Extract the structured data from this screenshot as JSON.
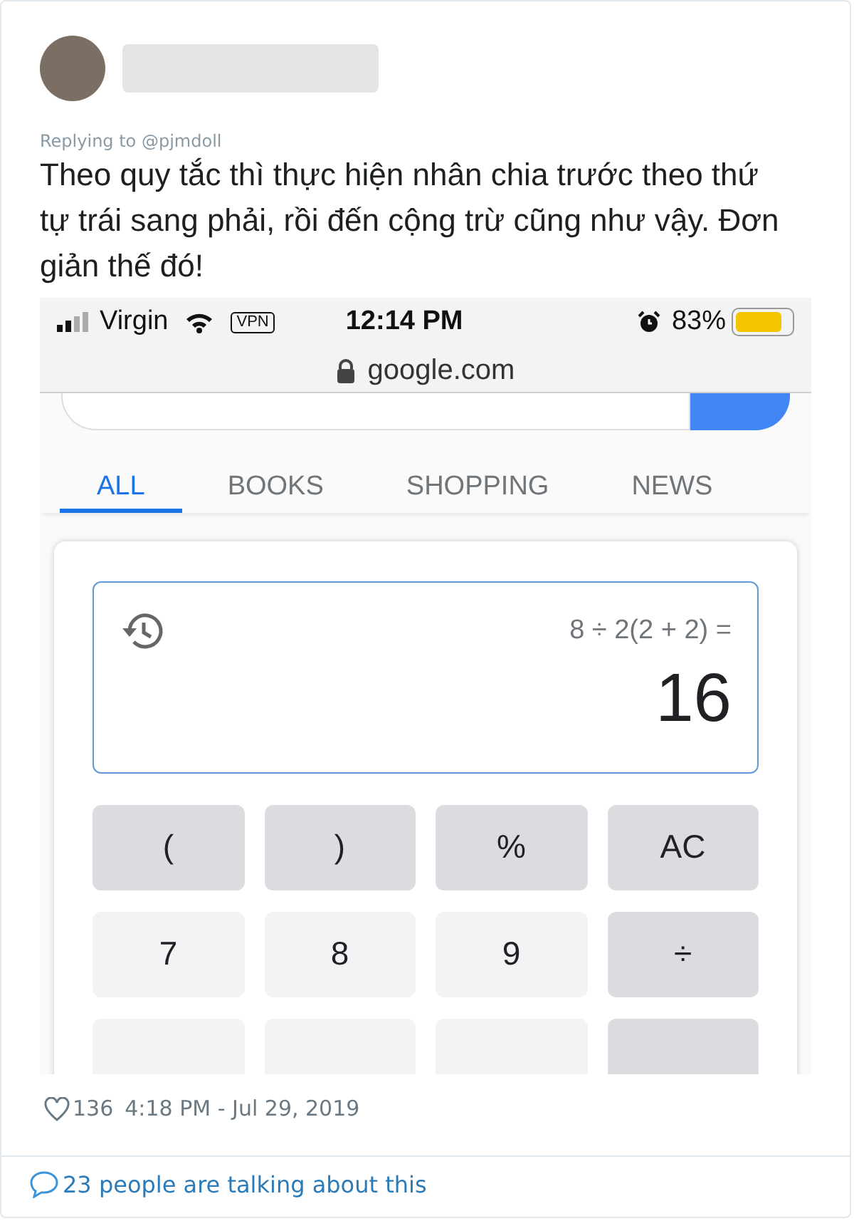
{
  "tweet": {
    "reply_to": "Replying to @pjmdoll",
    "text": "Theo quy tắc thì thực hiện nhân chia trước theo thứ tự trái sang phải, rồi đến cộng trừ cũng như vậy. Đơn giản thế đó!",
    "likes": "136",
    "timestamp": "4:18 PM - Jul 29, 2019",
    "conversation": "23 people are talking about this"
  },
  "phone": {
    "status_bar": {
      "carrier": "Virgin",
      "vpn": "VPN",
      "time": "12:14 PM",
      "battery": "83%",
      "battery_meter": {
        "level": 0.83
      },
      "url": "google.com"
    },
    "tabs": [
      {
        "label": "ALL",
        "selected": true
      },
      {
        "label": "BOOKS",
        "selected": false
      },
      {
        "label": "SHOPPING",
        "selected": false
      },
      {
        "label": "NEWS",
        "selected": false
      }
    ],
    "calculator": {
      "expression": "8 ÷ 2(2 + 2) =",
      "result": "16",
      "keys": [
        {
          "label": "(",
          "kind": "function"
        },
        {
          "label": ")",
          "kind": "function"
        },
        {
          "label": "%",
          "kind": "function"
        },
        {
          "label": "AC",
          "kind": "function"
        },
        {
          "label": "7",
          "kind": "digit"
        },
        {
          "label": "8",
          "kind": "digit"
        },
        {
          "label": "9",
          "kind": "digit"
        },
        {
          "label": "÷",
          "kind": "function"
        },
        {
          "kind": "digit"
        },
        {
          "kind": "digit"
        },
        {
          "kind": "digit"
        },
        {
          "kind": "function"
        }
      ]
    }
  }
}
